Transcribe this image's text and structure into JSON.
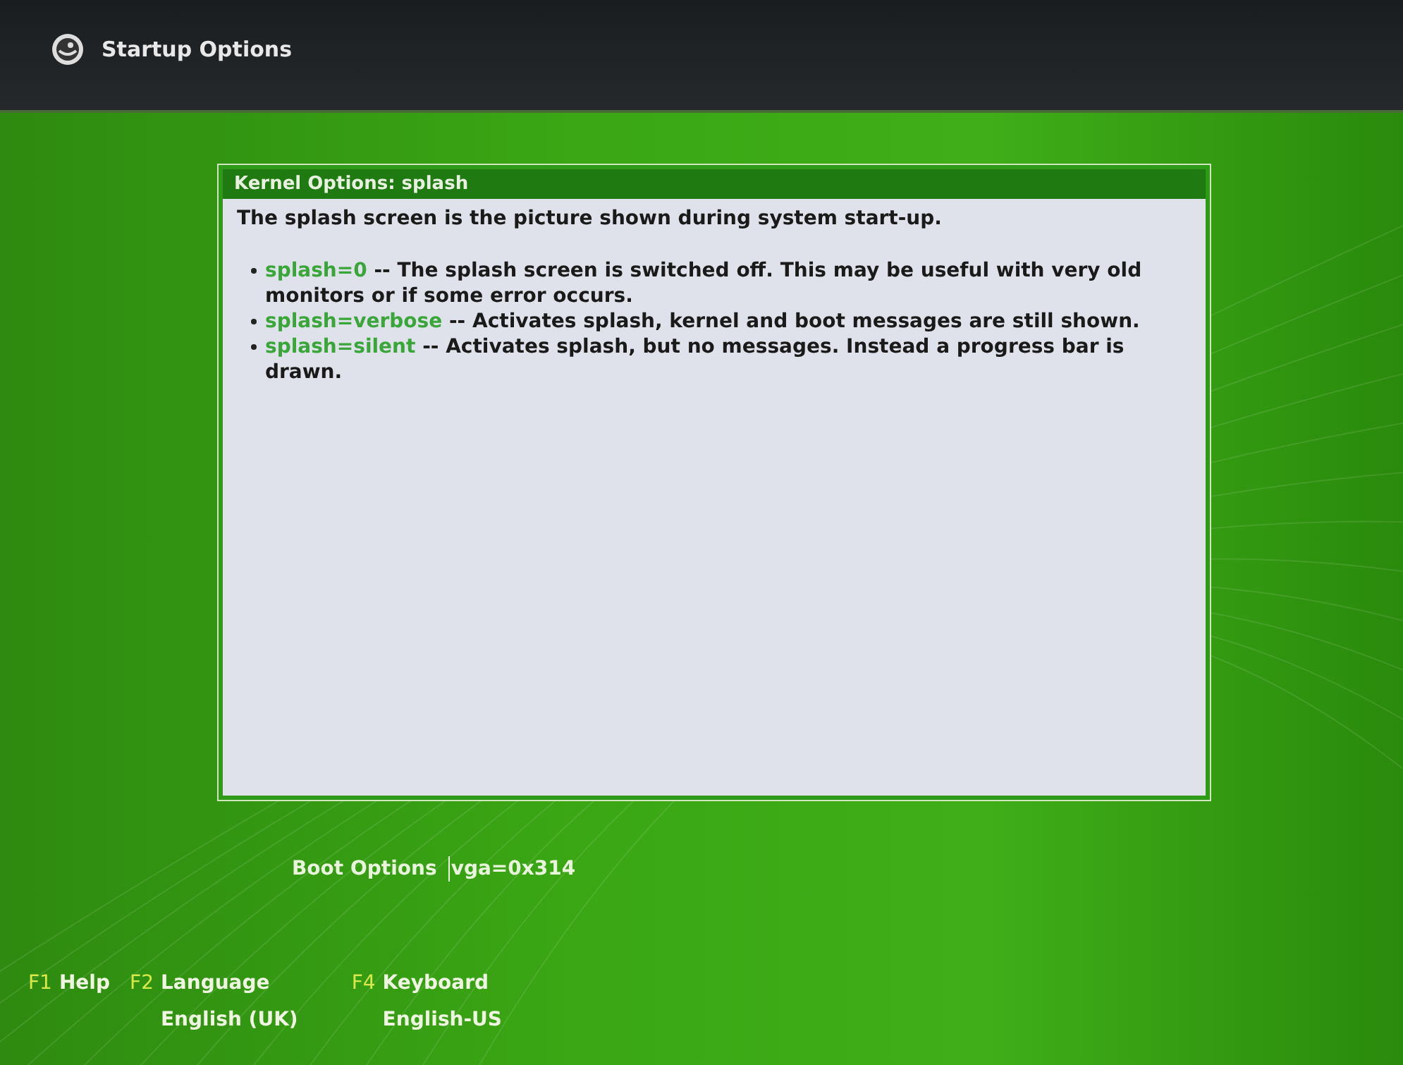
{
  "header": {
    "title": "Startup Options"
  },
  "panel": {
    "title": "Kernel Options: splash",
    "intro": "The splash screen is the picture shown during system start-up.",
    "items": [
      {
        "option": "splash=0",
        "text": "-- The splash screen is switched off. This may be useful with very old monitors or if some error occurs."
      },
      {
        "option": "splash=verbose",
        "text": "-- Activates splash, kernel and boot messages are still shown."
      },
      {
        "option": "splash=silent",
        "text": "-- Activates splash, but no messages. Instead a progress bar is drawn."
      }
    ]
  },
  "boot_options": {
    "label": "Boot Options",
    "value": "vga=0x314"
  },
  "function_keys": [
    {
      "key": "F1",
      "label": "Help"
    },
    {
      "key": "F2",
      "label": "Language",
      "value": "English (UK)"
    },
    {
      "key": "F4",
      "label": "Keyboard",
      "value": "English-US"
    }
  ]
}
